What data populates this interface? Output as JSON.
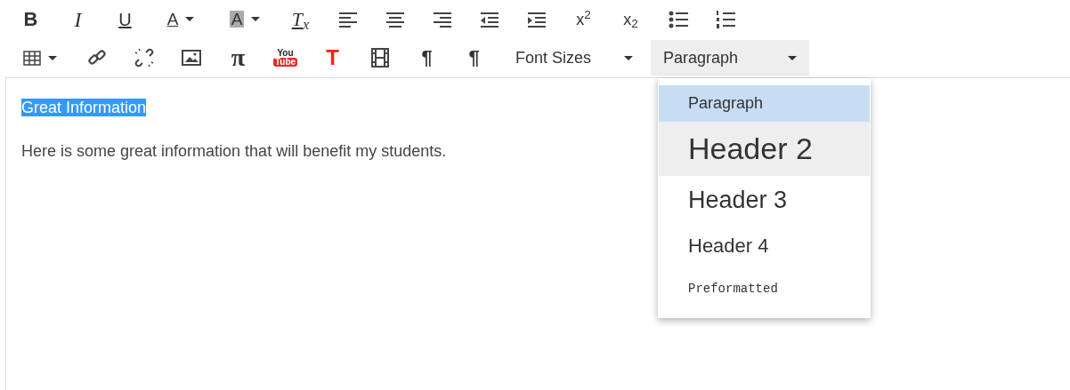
{
  "toolbar": {
    "top_row": [
      {
        "kind": "bold",
        "label": "B"
      },
      {
        "kind": "italic",
        "label": "I"
      },
      {
        "kind": "underline",
        "label": "U"
      },
      {
        "kind": "font-color",
        "label": "A",
        "caret": true
      },
      {
        "kind": "highlight",
        "label": "A",
        "caret": true
      },
      {
        "kind": "clear-format",
        "label": "T$_{x}$"
      },
      {
        "kind": "align-left"
      },
      {
        "kind": "align-center"
      },
      {
        "kind": "align-right"
      },
      {
        "kind": "outdent"
      },
      {
        "kind": "indent"
      },
      {
        "kind": "superscript",
        "label": "x$^{2}$"
      },
      {
        "kind": "subscript",
        "label": "x$_{2}$"
      },
      {
        "kind": "bullet-list"
      },
      {
        "kind": "numbered-list"
      }
    ],
    "bottom_row": [
      {
        "kind": "table",
        "caret": true
      },
      {
        "kind": "link"
      },
      {
        "kind": "unlink"
      },
      {
        "kind": "image"
      },
      {
        "kind": "math",
        "label": "π"
      },
      {
        "kind": "youtube",
        "label_top": "You",
        "label_bottom": "Tube"
      },
      {
        "kind": "text-tool",
        "label": "T"
      },
      {
        "kind": "film"
      },
      {
        "kind": "ltr",
        "label": "¶"
      },
      {
        "kind": "rtl",
        "label": "¶"
      },
      {
        "kind": "select",
        "label": "Font Sizes",
        "open": false
      },
      {
        "kind": "select",
        "label": "Paragraph",
        "open": true
      }
    ]
  },
  "format_menu": {
    "items": [
      {
        "kind": "p",
        "label": "Paragraph",
        "selected": true,
        "hovered": false
      },
      {
        "kind": "h2",
        "label": "Header 2",
        "selected": false,
        "hovered": true
      },
      {
        "kind": "h3",
        "label": "Header 3",
        "selected": false,
        "hovered": false
      },
      {
        "kind": "h4",
        "label": "Header 4",
        "selected": false,
        "hovered": false
      },
      {
        "kind": "pre",
        "label": "Preformatted",
        "selected": false,
        "hovered": false
      }
    ]
  },
  "editor": {
    "blocks": [
      {
        "text": "Great Information",
        "highlighted": true
      },
      {
        "text": "Here is some great information that will benefit my students.",
        "highlighted": false
      }
    ]
  }
}
